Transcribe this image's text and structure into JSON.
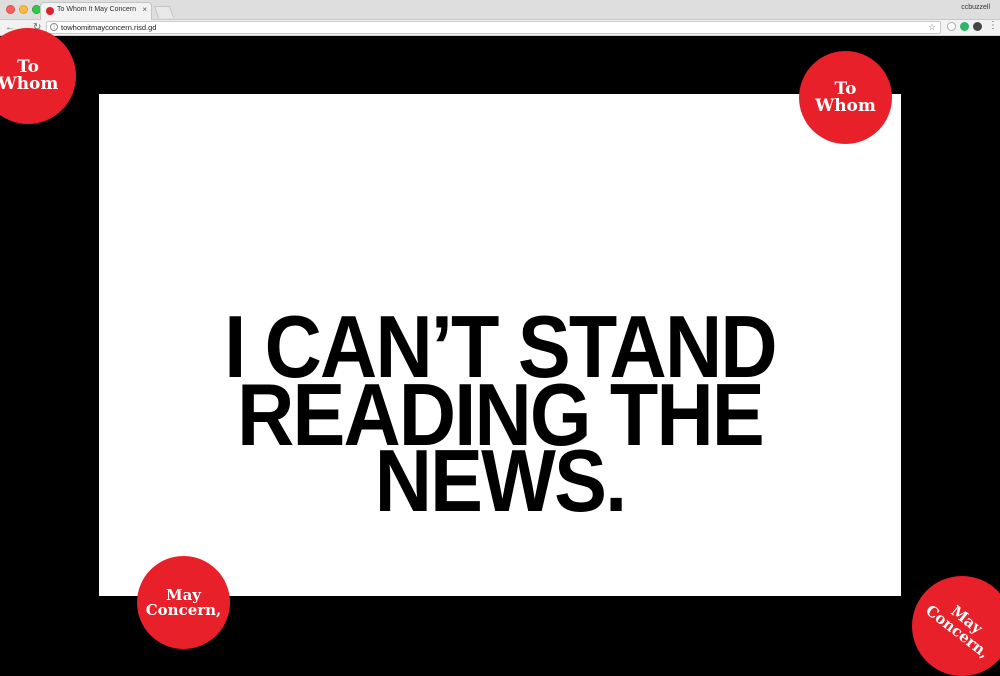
{
  "browser": {
    "tab_title": "To Whom It May Concern",
    "tab_close": "×",
    "profile_name": "ccbuzzell",
    "url": "towhomitmayconcern.risd.gd",
    "back_glyph": "←",
    "forward_glyph": "→",
    "reload_glyph": "↻",
    "star_glyph": "☆",
    "info_glyph": "i",
    "menu_glyph": "⋮"
  },
  "page": {
    "headline_lines": [
      "I CAN’T STAND",
      "READING THE NEWS."
    ],
    "badges": {
      "top_left": [
        "To",
        "Whom"
      ],
      "top_right": [
        "To",
        "Whom"
      ],
      "bottom_left": [
        "May",
        "Concern,"
      ],
      "bottom_right": [
        "May",
        "Concern,"
      ]
    }
  },
  "colors": {
    "badge_red": "#e8202a",
    "background": "#000000",
    "card": "#ffffff"
  }
}
